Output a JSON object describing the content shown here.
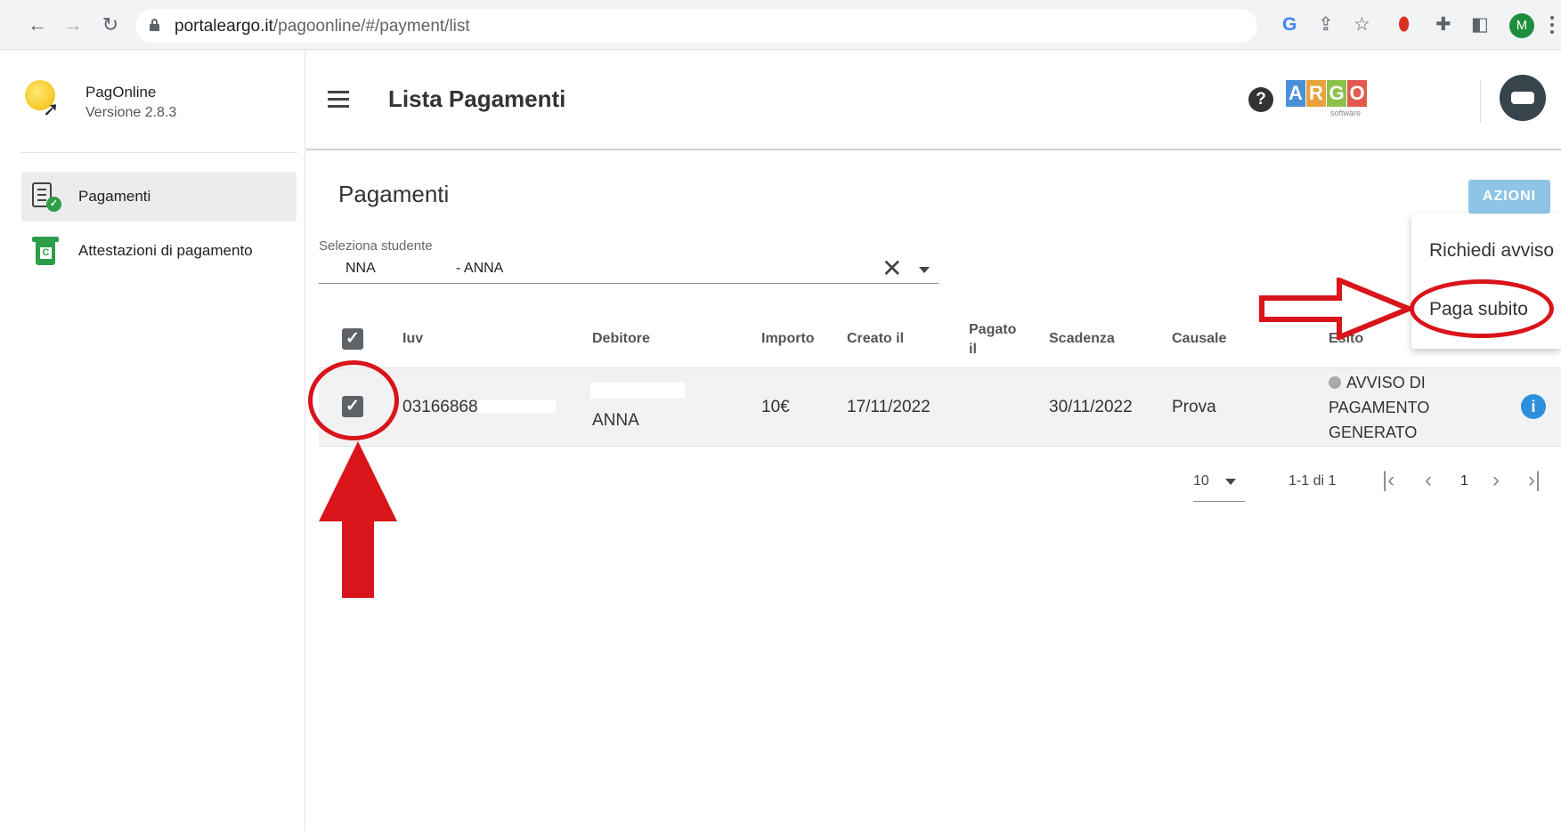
{
  "browser": {
    "back": "←",
    "forward": "→",
    "reload": "C",
    "url_host": "portaleargo.it",
    "url_path": "/pagoonline/#/payment/list",
    "profile_initial": "M"
  },
  "sidebar": {
    "app_name": "PagOnline",
    "app_version": "Versione 2.8.3",
    "items": [
      {
        "label": "Pagamenti",
        "active": true
      },
      {
        "label": "Attestazioni di pagamento",
        "active": false
      }
    ]
  },
  "header": {
    "title": "Lista Pagamenti",
    "logo_letters": [
      "A",
      "R",
      "G",
      "O"
    ],
    "logo_colors": [
      "#4a90d9",
      "#e8a33d",
      "#8bc34a",
      "#e05a4f"
    ],
    "logo_sub": "software"
  },
  "main": {
    "section_title": "Pagamenti",
    "actions_button": "AZIONI",
    "student_select": {
      "label": "Seleziona studente",
      "value_part1": "NNA",
      "value_part2": "- ANNA"
    },
    "table": {
      "columns": [
        "Iuv",
        "Debitore",
        "Importo",
        "Creato il",
        "Pagato il",
        "Scadenza",
        "Causale",
        "Esito"
      ],
      "rows": [
        {
          "iuv": "03166868",
          "debitore": "ANNA",
          "importo": "10€",
          "creato_il": "17/11/2022",
          "pagato_il": "",
          "scadenza": "30/11/2022",
          "causale": "Prova",
          "esito": "AVVISO DI PAGAMENTO GENERATO",
          "checked": true
        }
      ]
    },
    "pagination": {
      "page_size": "10",
      "range": "1-1 di 1",
      "current_page": "1"
    }
  },
  "menu": {
    "items": [
      "Richiedi avviso",
      "Paga subito"
    ]
  },
  "colors": {
    "annotation": "#d9141a",
    "actions_button": "#8ec5e6",
    "info_icon": "#2d8fdc"
  }
}
